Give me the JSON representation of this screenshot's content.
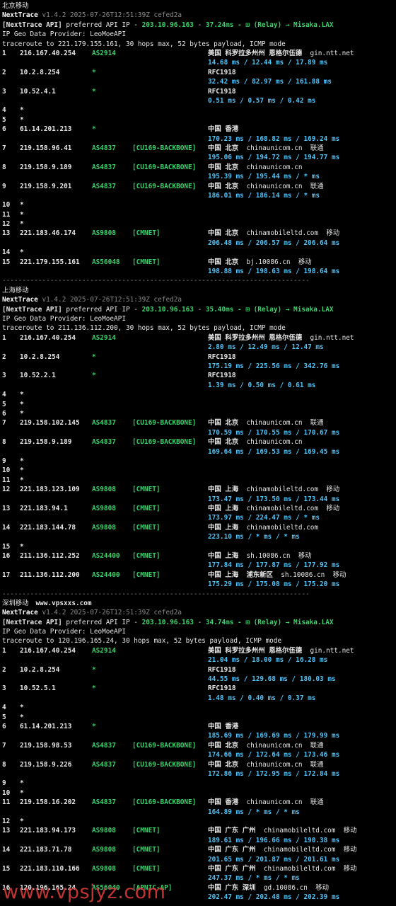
{
  "colors": {
    "background": "#000000",
    "ip_blue": "#4fc3f7",
    "asn_green": "#39d26b",
    "version_dim": "#8a8a8a",
    "watermark": "#d83a3a"
  },
  "separator": "-----------------------------------------------------------------------------",
  "blocks": [
    {
      "title": "北京移动",
      "site": "",
      "header": {
        "app": "NextTrace",
        "version": "v1.4.2 2025-07-26T12:51:39Z cefed2a"
      },
      "api_line": {
        "prefix": "[NextTrace API]",
        "text": " preferred API IP - ",
        "ip": "203.10.96.163",
        "sep": " - ",
        "latency": "37.24ms",
        "rest": " - ⊞ (Relay) → Misaka.LAX"
      },
      "geo_provider": "IP Geo Data Provider: LeoMoeAPI",
      "traceroute": "traceroute to 221.179.155.161, 30 hops max, 52 bytes payload, ICMP mode",
      "hops": [
        {
          "n": "1",
          "ip": "216.167.40.254",
          "as": "AS2914",
          "tag": "",
          "geo": "美国 科罗拉多州州 恩格尔伍德",
          "host": "gin.ntt.net",
          "rtt": "14.68 ms / 12.44 ms / 17.89 ms"
        },
        {
          "n": "2",
          "ip": "10.2.8.254",
          "as": "*",
          "tag": "",
          "geo": "RFC1918",
          "host": "",
          "rtt": "32.42 ms / 82.97 ms / 161.88 ms"
        },
        {
          "n": "3",
          "ip": "10.52.4.1",
          "as": "*",
          "tag": "",
          "geo": "RFC1918",
          "host": "",
          "rtt": "0.51 ms / 0.57 ms / 0.42 ms"
        },
        {
          "n": "4",
          "ip": "*"
        },
        {
          "n": "5",
          "ip": "*"
        },
        {
          "n": "6",
          "ip": "61.14.201.213",
          "as": "*",
          "tag": "",
          "geo": "中国 香港",
          "host": "",
          "rtt": "170.23 ms / 168.82 ms / 169.24 ms"
        },
        {
          "n": "7",
          "ip": "219.158.96.41",
          "as": "AS4837",
          "tag": "[CU169-BACKBONE]",
          "geo": "中国 北京",
          "host": "chinaunicom.cn  联通",
          "rtt": "195.06 ms / 194.72 ms / 194.77 ms"
        },
        {
          "n": "8",
          "ip": "219.158.9.189",
          "as": "AS4837",
          "tag": "[CU169-BACKBONE]",
          "geo": "中国 北京",
          "host": "chinaunicom.cn",
          "rtt": "195.39 ms / 195.44 ms / * ms"
        },
        {
          "n": "9",
          "ip": "219.158.9.201",
          "as": "AS4837",
          "tag": "[CU169-BACKBONE]",
          "geo": "中国 北京",
          "host": "chinaunicom.cn  联通",
          "rtt": "186.01 ms / 186.14 ms / * ms"
        },
        {
          "n": "10",
          "ip": "*"
        },
        {
          "n": "11",
          "ip": "*"
        },
        {
          "n": "12",
          "ip": "*"
        },
        {
          "n": "13",
          "ip": "221.183.46.174",
          "as": "AS9808",
          "tag": "[CMNET]",
          "geo": "中国 北京",
          "host": "chinamobileltd.com  移动",
          "rtt": "206.48 ms / 206.57 ms / 206.64 ms"
        },
        {
          "n": "14",
          "ip": "*"
        },
        {
          "n": "15",
          "ip": "221.179.155.161",
          "as": "AS56048",
          "tag": "[CMNET]",
          "geo": "中国 北京",
          "host": "bj.10086.cn  移动",
          "rtt": "198.88 ms / 198.63 ms / 198.64 ms"
        }
      ]
    },
    {
      "title": "上海移动",
      "site": "",
      "header": {
        "app": "NextTrace",
        "version": "v1.4.2 2025-07-26T12:51:39Z cefed2a"
      },
      "api_line": {
        "prefix": "[NextTrace API]",
        "text": " preferred API IP - ",
        "ip": "203.10.96.163",
        "sep": " - ",
        "latency": "35.40ms",
        "rest": " - ⊞ (Relay) → Misaka.LAX"
      },
      "geo_provider": "IP Geo Data Provider: LeoMoeAPI",
      "traceroute": "traceroute to 211.136.112.200, 30 hops max, 52 bytes payload, ICMP mode",
      "hops": [
        {
          "n": "1",
          "ip": "216.167.40.254",
          "as": "AS2914",
          "tag": "",
          "geo": "美国 科罗拉多州州 恩格尔伍德",
          "host": "gin.ntt.net",
          "rtt": "2.80 ms / 12.49 ms / 12.47 ms"
        },
        {
          "n": "2",
          "ip": "10.2.8.254",
          "as": "*",
          "tag": "",
          "geo": "RFC1918",
          "host": "",
          "rtt": "175.19 ms / 225.56 ms / 342.76 ms"
        },
        {
          "n": "3",
          "ip": "10.52.2.1",
          "as": "*",
          "tag": "",
          "geo": "RFC1918",
          "host": "",
          "rtt": "1.39 ms / 0.50 ms / 0.61 ms"
        },
        {
          "n": "4",
          "ip": "*"
        },
        {
          "n": "5",
          "ip": "*"
        },
        {
          "n": "6",
          "ip": "*"
        },
        {
          "n": "7",
          "ip": "219.158.102.145",
          "as": "AS4837",
          "tag": "[CU169-BACKBONE]",
          "geo": "中国 北京",
          "host": "chinaunicom.cn  联通",
          "rtt": "170.59 ms / 170.55 ms / 170.67 ms"
        },
        {
          "n": "8",
          "ip": "219.158.9.189",
          "as": "AS4837",
          "tag": "[CU169-BACKBONE]",
          "geo": "中国 北京",
          "host": "chinaunicom.cn",
          "rtt": "169.64 ms / 169.53 ms / 169.45 ms"
        },
        {
          "n": "9",
          "ip": "*"
        },
        {
          "n": "10",
          "ip": "*"
        },
        {
          "n": "11",
          "ip": "*"
        },
        {
          "n": "12",
          "ip": "221.183.123.109",
          "as": "AS9808",
          "tag": "[CMNET]",
          "geo": "中国 上海",
          "host": "chinamobileltd.com  移动",
          "rtt": "173.47 ms / 173.50 ms / 173.44 ms"
        },
        {
          "n": "13",
          "ip": "221.183.94.1",
          "as": "AS9808",
          "tag": "[CMNET]",
          "geo": "中国 上海",
          "host": "chinamobileltd.com  移动",
          "rtt": "173.97 ms / 224.47 ms / * ms"
        },
        {
          "n": "14",
          "ip": "221.183.144.78",
          "as": "AS9808",
          "tag": "[CMNET]",
          "geo": "中国 上海",
          "host": "chinamobileltd.com",
          "rtt": "223.10 ms / * ms / * ms"
        },
        {
          "n": "15",
          "ip": "*"
        },
        {
          "n": "16",
          "ip": "211.136.112.252",
          "as": "AS24400",
          "tag": "[CMNET]",
          "geo": "中国 上海",
          "host": "sh.10086.cn  移动",
          "rtt": "177.84 ms / 177.87 ms / 177.92 ms"
        },
        {
          "n": "17",
          "ip": "211.136.112.200",
          "as": "AS24400",
          "tag": "[CMNET]",
          "geo": "中国 上海  浦东新区",
          "host": "sh.10086.cn  移动",
          "rtt": "175.29 ms / 175.08 ms / 175.20 ms"
        }
      ]
    },
    {
      "title": "深圳移动",
      "site": "www.vpsxxs.com",
      "header": {
        "app": "NextTrace",
        "version": "v1.4.2 2025-07-26T12:51:39Z cefed2a"
      },
      "api_line": {
        "prefix": "[NextTrace API]",
        "text": " preferred API IP - ",
        "ip": "203.10.96.163",
        "sep": " - ",
        "latency": "34.74ms",
        "rest": " - ⊞ (Relay) → Misaka.LAX"
      },
      "geo_provider": "IP Geo Data Provider: LeoMoeAPI",
      "traceroute": "traceroute to 120.196.165.24, 30 hops max, 52 bytes payload, ICMP mode",
      "hops": [
        {
          "n": "1",
          "ip": "216.167.40.254",
          "as": "AS2914",
          "tag": "",
          "geo": "美国 科罗拉多州州 恩格尔伍德",
          "host": "gin.ntt.net",
          "rtt": "21.04 ms / 18.00 ms / 16.28 ms"
        },
        {
          "n": "2",
          "ip": "10.2.8.254",
          "as": "*",
          "tag": "",
          "geo": "RFC1918",
          "host": "",
          "rtt": "44.55 ms / 129.68 ms / 180.03 ms"
        },
        {
          "n": "3",
          "ip": "10.52.5.1",
          "as": "*",
          "tag": "",
          "geo": "RFC1918",
          "host": "",
          "rtt": "1.48 ms / 0.40 ms / 0.37 ms"
        },
        {
          "n": "4",
          "ip": "*"
        },
        {
          "n": "5",
          "ip": "*"
        },
        {
          "n": "6",
          "ip": "61.14.201.213",
          "as": "*",
          "tag": "",
          "geo": "中国 香港",
          "host": "",
          "rtt": "185.69 ms / 169.69 ms / 179.99 ms"
        },
        {
          "n": "7",
          "ip": "219.158.98.53",
          "as": "AS4837",
          "tag": "[CU169-BACKBONE]",
          "geo": "中国 北京",
          "host": "chinaunicom.cn  联通",
          "rtt": "174.66 ms / 172.64 ms / 173.46 ms"
        },
        {
          "n": "8",
          "ip": "219.158.9.226",
          "as": "AS4837",
          "tag": "[CU169-BACKBONE]",
          "geo": "中国 北京",
          "host": "chinaunicom.cn  联通",
          "rtt": "172.86 ms / 172.95 ms / 172.84 ms"
        },
        {
          "n": "9",
          "ip": "*"
        },
        {
          "n": "10",
          "ip": "*"
        },
        {
          "n": "11",
          "ip": "219.158.16.202",
          "as": "AS4837",
          "tag": "[CU169-BACKBONE]",
          "geo": "中国 香港",
          "host": "chinaunicom.cn  联通",
          "rtt": "164.89 ms / * ms / * ms"
        },
        {
          "n": "12",
          "ip": "*"
        },
        {
          "n": "13",
          "ip": "221.183.94.173",
          "as": "AS9808",
          "tag": "[CMNET]",
          "geo": "中国 广东 广州",
          "host": "chinamobileltd.com  移动",
          "rtt": "189.61 ms / 196.66 ms / 190.38 ms"
        },
        {
          "n": "14",
          "ip": "221.183.71.78",
          "as": "AS9808",
          "tag": "[CMNET]",
          "geo": "中国 广东 广州",
          "host": "chinamobileltd.com  移动",
          "rtt": "201.65 ms / 201.87 ms / 201.61 ms"
        },
        {
          "n": "15",
          "ip": "221.183.110.166",
          "as": "AS9808",
          "tag": "[CMNET]",
          "geo": "中国 广东 广州",
          "host": "chinamobileltd.com  移动",
          "rtt": "247.37 ms / * ms / * ms"
        },
        {
          "n": "16",
          "ip": "120.196.165.24",
          "as": "AS56040",
          "tag": "[APNIC-AP]",
          "geo": "中国 广东 深圳",
          "host": "gd.10086.cn  移动",
          "rtt": "202.47 ms / 202.48 ms / 202.39 ms"
        }
      ]
    }
  ],
  "watermark": "www.vpsjyz.com"
}
